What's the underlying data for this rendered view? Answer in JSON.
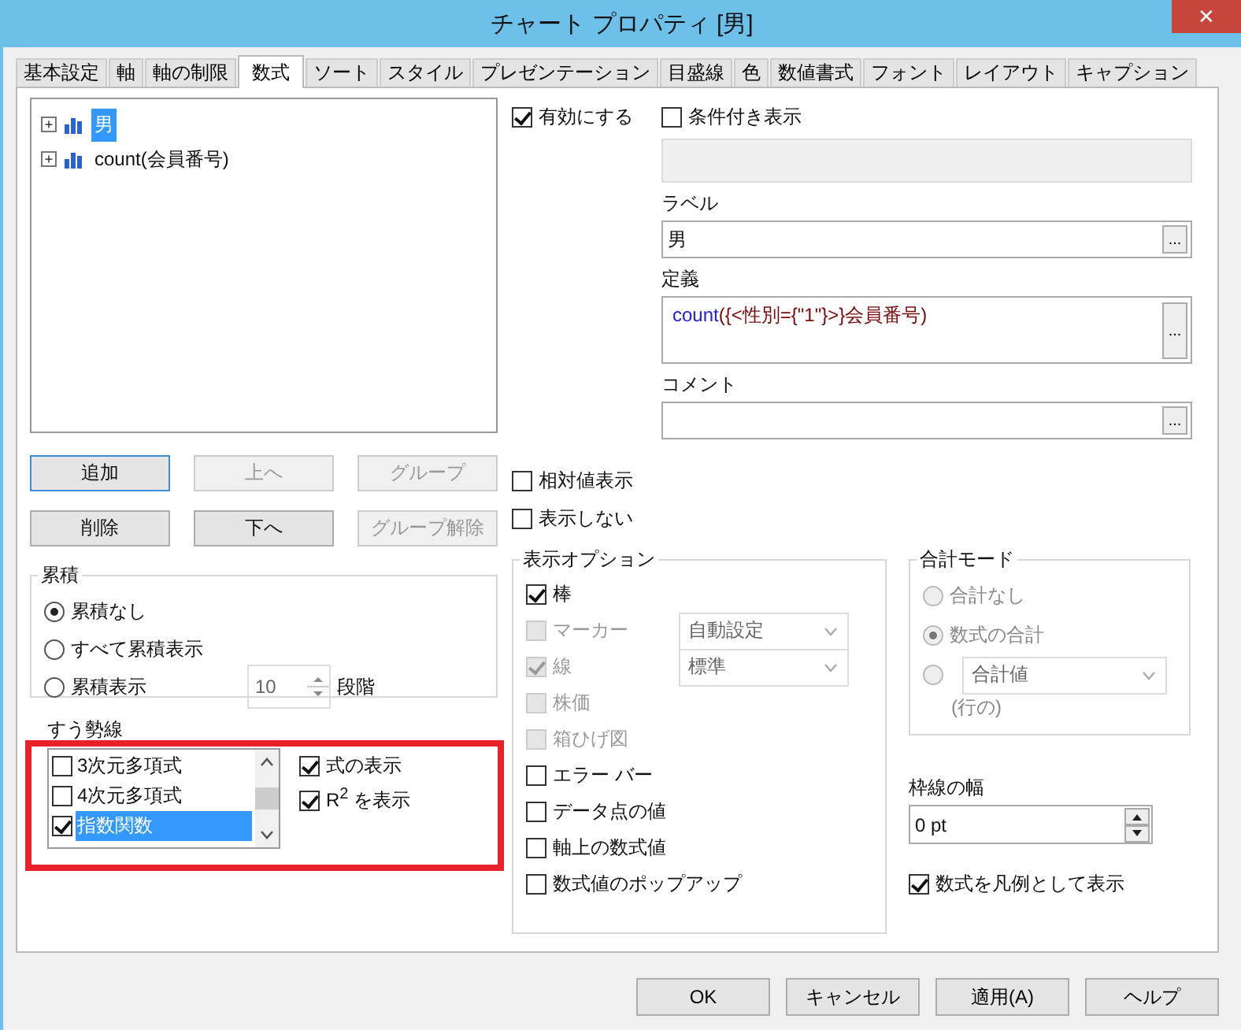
{
  "window": {
    "title": "チャート プロパティ [男]",
    "close": "✕"
  },
  "tabs": [
    {
      "label": "基本設定",
      "selected": false
    },
    {
      "label": "軸",
      "selected": false
    },
    {
      "label": "軸の制限",
      "selected": false
    },
    {
      "label": "数式",
      "selected": true
    },
    {
      "label": "ソート",
      "selected": false
    },
    {
      "label": "スタイル",
      "selected": false
    },
    {
      "label": "プレゼンテーション",
      "selected": false
    },
    {
      "label": "目盛線",
      "selected": false
    },
    {
      "label": "色",
      "selected": false
    },
    {
      "label": "数値書式",
      "selected": false
    },
    {
      "label": "フォント",
      "selected": false
    },
    {
      "label": "レイアウト",
      "selected": false
    },
    {
      "label": "キャプション",
      "selected": false
    }
  ],
  "tree": [
    {
      "expander": "+",
      "label": "男",
      "selected": true
    },
    {
      "expander": "+",
      "label": "count(会員番号)",
      "selected": false
    }
  ],
  "list_buttons": [
    {
      "label": "追加",
      "disabled": false,
      "focused": true
    },
    {
      "label": "上へ",
      "disabled": true,
      "focused": false
    },
    {
      "label": "グループ",
      "disabled": true,
      "focused": false
    },
    {
      "label": "削除",
      "disabled": false,
      "focused": false
    },
    {
      "label": "下へ",
      "disabled": false,
      "focused": false
    },
    {
      "label": "グループ解除",
      "disabled": true,
      "focused": false
    }
  ],
  "accumulation": {
    "title": "累積",
    "options": [
      {
        "label": "累積なし",
        "selected": true
      },
      {
        "label": "すべて累積表示",
        "selected": false
      },
      {
        "label": "累積表示",
        "selected": false
      }
    ],
    "steps": "10",
    "steps_unit": "段階"
  },
  "trendlines": {
    "title": "すう勢線",
    "items": [
      {
        "label": "3次元多項式",
        "checked": false,
        "selected": false
      },
      {
        "label": "4次元多項式",
        "checked": false,
        "selected": false
      },
      {
        "label": "指数関数",
        "checked": true,
        "selected": true
      }
    ],
    "options": [
      {
        "label": "式の表示",
        "checked": true
      },
      {
        "label": "R$^{2}$ を表示",
        "checked": true
      }
    ]
  },
  "enable": {
    "label": "有効にする",
    "checked": true
  },
  "conditional": {
    "label": "条件付き表示",
    "checked": false
  },
  "label_field": {
    "label": "ラベル",
    "value": "男",
    "button": "..."
  },
  "definition": {
    "label": "定義",
    "tokens": [
      {
        "text": "count",
        "kind": "function"
      },
      {
        "text": "({<性別={\"1\"}>}会員番号)",
        "kind": "text"
      }
    ],
    "button": "..."
  },
  "comment": {
    "label": "コメント",
    "button": "..."
  },
  "relative": {
    "label": "相対値表示",
    "checked": false
  },
  "invisible": {
    "label": "表示しない",
    "checked": false
  },
  "display_options": {
    "title": "表示オプション",
    "items": [
      {
        "label": "棒",
        "checked": true,
        "disabled": false
      },
      {
        "label": "マーカー",
        "checked": false,
        "disabled": true,
        "select": "自動設定"
      },
      {
        "label": "線",
        "checked": true,
        "disabled": true,
        "select": "標準"
      },
      {
        "label": "株価",
        "checked": false,
        "disabled": true
      },
      {
        "label": "箱ひげ図",
        "checked": false,
        "disabled": true
      },
      {
        "label": "エラー バー",
        "checked": false,
        "disabled": false
      },
      {
        "label": "データ点の値",
        "checked": false,
        "disabled": false
      },
      {
        "label": "軸上の数式値",
        "checked": false,
        "disabled": false
      },
      {
        "label": "数式値のポップアップ",
        "checked": false,
        "disabled": false
      }
    ]
  },
  "total_mode": {
    "title": "合計モード",
    "disabled": true,
    "options": [
      {
        "label": "合計なし",
        "selected": false
      },
      {
        "label": "数式の合計",
        "selected": true
      },
      {
        "select": "合計値",
        "selected": false
      }
    ],
    "suffix": "(行の)"
  },
  "line_width": {
    "label": "枠線の幅",
    "value": "0 pt"
  },
  "legend_option": {
    "label": "数式を凡例として表示",
    "checked": true
  },
  "footer_buttons": [
    "OK",
    "キャンセル",
    "適用(A)",
    "ヘルプ"
  ]
}
